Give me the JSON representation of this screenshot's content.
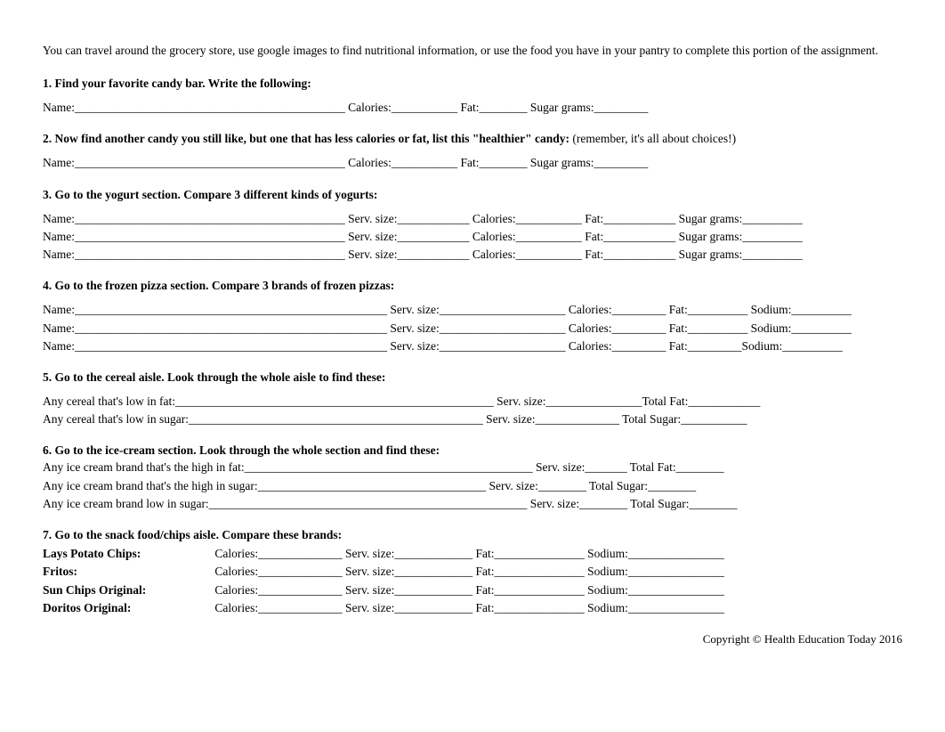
{
  "intro": "You can travel around the grocery store, use google images to find nutritional information, or use the food you have in your pantry to complete this portion of the assignment.",
  "q1": {
    "head": "1. Find your favorite candy bar. Write the following:",
    "line": "Name:_____________________________________________ Calories:___________ Fat:________ Sugar grams:_________"
  },
  "q2": {
    "head": "2. Now find another candy you still like, but one that has less calories or fat, list this \"healthier\" candy:",
    "tail": "   (remember, it's all about choices!)",
    "line": "Name:_____________________________________________ Calories:___________ Fat:________ Sugar grams:_________"
  },
  "q3": {
    "head": "3. Go to the yogurt section. Compare 3 different kinds of yogurts:",
    "rows": [
      "Name:_____________________________________________ Serv. size:____________ Calories:___________ Fat:____________ Sugar grams:__________",
      "Name:_____________________________________________ Serv. size:____________ Calories:___________ Fat:____________ Sugar grams:__________",
      "Name:_____________________________________________ Serv. size:____________ Calories:___________ Fat:____________ Sugar grams:__________"
    ]
  },
  "q4": {
    "head": "4. Go to the frozen pizza section. Compare 3 brands of frozen pizzas:",
    "rows": [
      "Name:____________________________________________________ Serv. size:_____________________ Calories:_________ Fat:__________ Sodium:__________",
      "Name:____________________________________________________ Serv. size:_____________________ Calories:_________ Fat:__________ Sodium:__________",
      "Name:____________________________________________________ Serv. size:_____________________ Calories:_________ Fat:_________Sodium:__________"
    ]
  },
  "q5": {
    "head": "5. Go to the cereal aisle. Look through the whole aisle to find these:",
    "rows": [
      "Any cereal that's low in fat:_____________________________________________________ Serv. size:________________Total Fat:____________",
      "Any cereal that's low in sugar:_________________________________________________ Serv. size:______________ Total Sugar:___________"
    ]
  },
  "q6": {
    "head": "6. Go to the ice-cream section. Look through the whole section and find these:",
    "rows": [
      "Any ice cream brand that's the high in fat:________________________________________________ Serv. size:_______ Total Fat:________",
      "Any ice cream brand that's the high in sugar:______________________________________ Serv. size:________ Total Sugar:________",
      "Any ice cream brand low in sugar:_____________________________________________________ Serv. size:________ Total Sugar:________"
    ]
  },
  "q7": {
    "head": "7. Go to the snack food/chips aisle. Compare these brands:",
    "brands": [
      {
        "name": "Lays Potato Chips:",
        "fields": "Calories:______________ Serv. size:_____________ Fat:_______________ Sodium:________________"
      },
      {
        "name": "Fritos:",
        "fields": "Calories:______________ Serv. size:_____________ Fat:_______________ Sodium:________________"
      },
      {
        "name": "Sun Chips Original:",
        "fields": "Calories:______________ Serv. size:_____________ Fat:_______________ Sodium:________________"
      },
      {
        "name": "Doritos Original:",
        "fields": "Calories:______________ Serv. size:_____________ Fat:_______________ Sodium:________________"
      }
    ]
  },
  "footer": "Copyright © Health Education Today 2016"
}
